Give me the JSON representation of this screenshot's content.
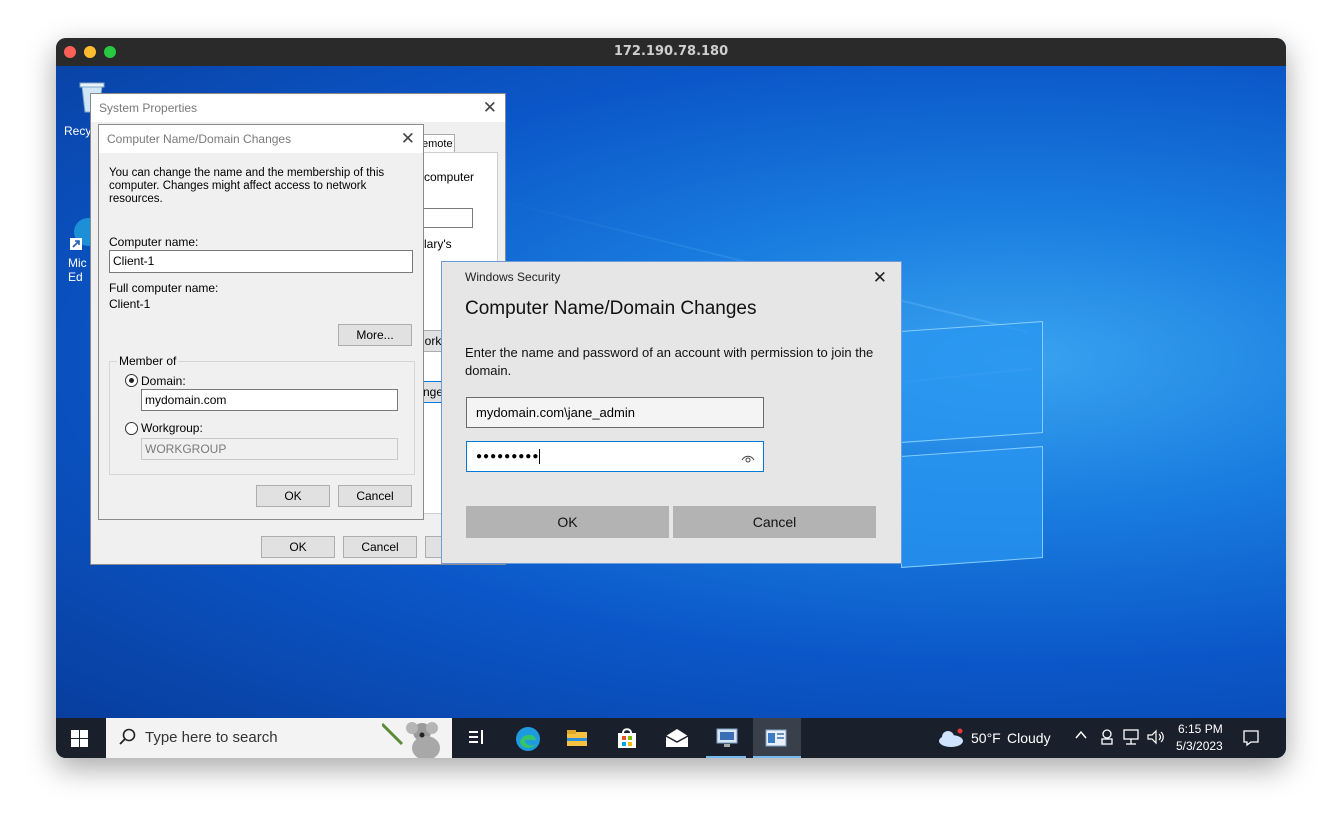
{
  "window": {
    "title": "172.190.78.180"
  },
  "desktop": {
    "icons": [
      {
        "label": "Recy"
      },
      {
        "label": "Mic\nEd"
      }
    ]
  },
  "system_properties": {
    "title": "System Properties",
    "tab_partial": "emote",
    "frag_computer": "computer",
    "frag_lary": "lary's",
    "frag_ork": "ork I",
    "frag_nge": "nge",
    "ok": "OK",
    "cancel": "Cancel"
  },
  "domain_changes": {
    "title": "Computer Name/Domain Changes",
    "intro": "You can change the name and the membership of this computer. Changes might affect access to network resources.",
    "computer_name_label": "Computer name:",
    "computer_name_value": "Client-1",
    "full_name_label": "Full computer name:",
    "full_name_value": "Client-1",
    "more_button": "More...",
    "member_of_label": "Member of",
    "domain_label": "Domain:",
    "domain_value": "mydomain.com",
    "workgroup_label": "Workgroup:",
    "workgroup_value": "WORKGROUP",
    "ok": "OK",
    "cancel": "Cancel"
  },
  "security": {
    "app": "Windows Security",
    "heading": "Computer Name/Domain Changes",
    "description": "Enter the name and password of an account with permission to join the domain.",
    "username_value": "mydomain.com\\jane_admin",
    "password_mask": "●●●●●●●●●",
    "ok": "OK",
    "cancel": "Cancel"
  },
  "taskbar": {
    "search_placeholder": "Type here to search",
    "weather_temp": "50°F",
    "weather_desc": "Cloudy",
    "time": "6:15 PM",
    "date": "5/3/2023"
  },
  "colors": {
    "accent": "#0078d7",
    "taskbar": "#1a1f2c"
  }
}
